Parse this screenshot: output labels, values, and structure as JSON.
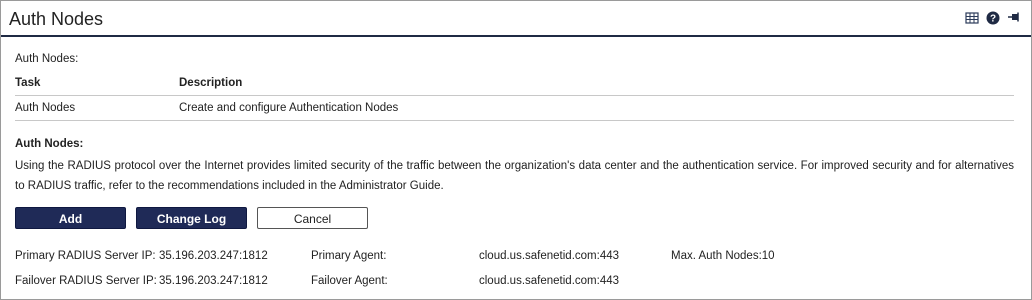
{
  "window": {
    "title": "Auth Nodes"
  },
  "toolbar_icons": [
    "table-icon",
    "help-icon",
    "pin-icon"
  ],
  "section1": {
    "label": "Auth Nodes:",
    "table": {
      "headers": [
        "Task",
        "Description"
      ],
      "rows": [
        {
          "task": "Auth Nodes",
          "description": "Create and configure Authentication Nodes"
        }
      ]
    }
  },
  "section2": {
    "heading": "Auth Nodes:",
    "paragraph": "Using the RADIUS protocol over the Internet provides limited security of the traffic between the organization's data center and the authentication service. For improved security and for alternatives to RADIUS traffic, refer to the recommendations included in the Administrator Guide."
  },
  "buttons": {
    "add": "Add",
    "change_log": "Change Log",
    "cancel": "Cancel"
  },
  "info": {
    "primary_ip_label": "Primary RADIUS Server IP:",
    "primary_ip_value": "35.196.203.247:1812",
    "failover_ip_label": "Failover RADIUS Server IP:",
    "failover_ip_value": "35.196.203.247:1812",
    "primary_agent_label": "Primary Agent:",
    "primary_agent_value": "cloud.us.safenetid.com:443",
    "failover_agent_label": "Failover Agent:",
    "failover_agent_value": "cloud.us.safenetid.com:443",
    "max_nodes": "Max. Auth Nodes:10"
  },
  "colors": {
    "accent": "#1f2a57",
    "title_rule": "#1f2a44",
    "help_icon": "#1f2a44"
  }
}
